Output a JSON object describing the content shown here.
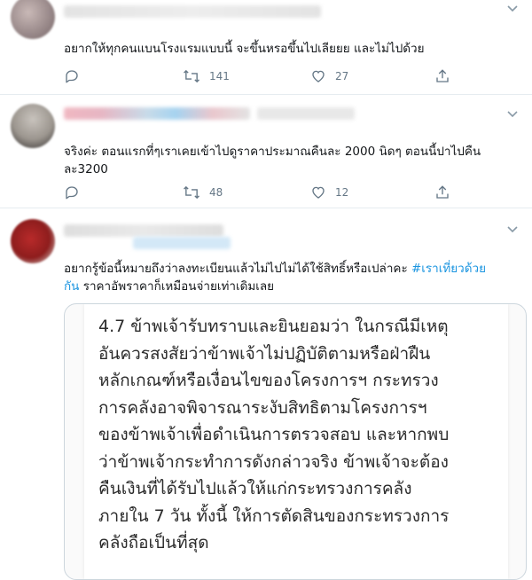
{
  "tweets": [
    {
      "text": "อยากให้ทุกคนแบนโรงแรมแบบนี้ จะขึ้นหรอขึ้นไปเลียยย และไม่ไปด้วย",
      "reply_count": "",
      "retweet_count": "141",
      "like_count": "27"
    },
    {
      "text_line1": "จริงค่ะ ตอนแรกที่ๆเราเคยเข้าไปดูราคาประมาณคืนละ 2000 นิดๆ ตอนนี้ปาไปคืน",
      "text_line2": "ละ3200",
      "reply_count": "",
      "retweet_count": "48",
      "like_count": "12"
    },
    {
      "text_line1_a": "อยากรู้ข้อนี้หมายถึงว่าลงทะเบียนแล้วไม่ไปไม่ได้ใช้สิทธิ์หรือเปล่าคะ ",
      "hashtag_a": "#เราเที่ยวด้วย",
      "hashtag_b": "กัน",
      "text_line2_b": " ราคาอัพราคาก็เหมือนจ่ายเท่าเดิมเลย",
      "image_text": [
        "4.7 ข้าพเจ้ารับทราบและยินยอมว่า ในกรณีมีเหตุ",
        "อันควรสงสัยว่าข้าพเจ้าไม่ปฏิบัติตามหรือฝ่าฝืน",
        "หลักเกณฑ์หรือเงื่อนไขของโครงการฯ กระทรวง",
        "การคลังอาจพิจารณาระงับสิทธิตามโครงการฯ",
        "ของข้าพเจ้าเพื่อดำเนินการตรวจสอบ และหากพบ",
        "ว่าข้าพเจ้ากระทำการดังกล่าวจริง ข้าพเจ้าจะต้อง",
        "คืนเงินที่ได้รับไปแล้วให้แก่กระทรวงการคลัง",
        "ภายใน 7 วัน ทั้งนี้ ให้การตัดสินของกระทรวงการ",
        "คลังถือเป็นที่สุด"
      ]
    }
  ],
  "colors": {
    "text": "#14171a",
    "secondary": "#657786",
    "link": "#1b95e0",
    "divider": "#e6ecf0"
  },
  "icons": [
    "reply-icon",
    "retweet-icon",
    "like-icon",
    "share-icon",
    "chevron-down-icon"
  ]
}
